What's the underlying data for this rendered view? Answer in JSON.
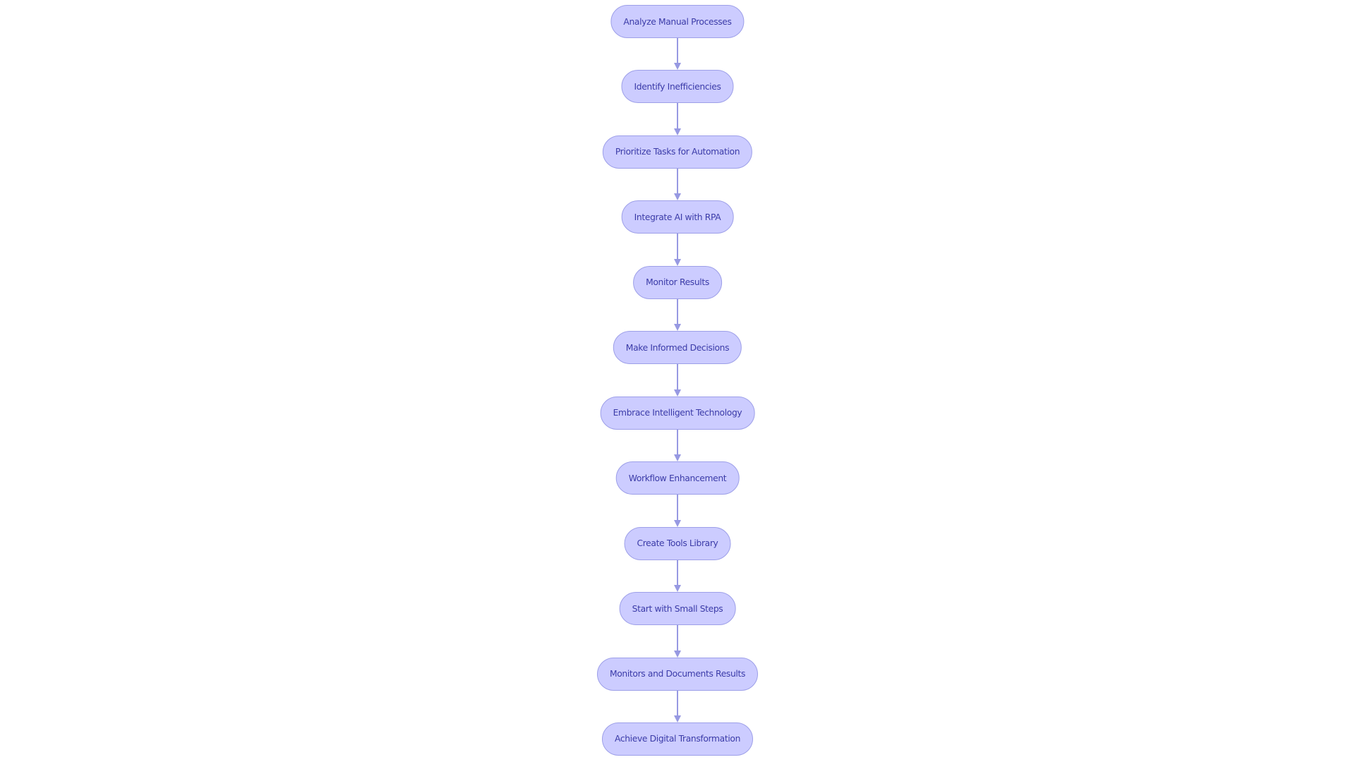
{
  "diagram": {
    "type": "flowchart",
    "direction": "top-to-bottom",
    "colors": {
      "node_fill": "#ccccff",
      "node_border": "#9d9fe8",
      "node_text": "#3b3ba8",
      "edge": "#9799e2",
      "background": "#ffffff"
    },
    "nodes": [
      {
        "id": "n1",
        "label": "Analyze Manual Processes"
      },
      {
        "id": "n2",
        "label": "Identify Inefficiencies"
      },
      {
        "id": "n3",
        "label": "Prioritize Tasks for Automation"
      },
      {
        "id": "n4",
        "label": "Integrate AI with RPA"
      },
      {
        "id": "n5",
        "label": "Monitor Results"
      },
      {
        "id": "n6",
        "label": "Make Informed Decisions"
      },
      {
        "id": "n7",
        "label": "Embrace Intelligent Technology"
      },
      {
        "id": "n8",
        "label": "Workflow Enhancement"
      },
      {
        "id": "n9",
        "label": "Create Tools Library"
      },
      {
        "id": "n10",
        "label": "Start with Small Steps"
      },
      {
        "id": "n11",
        "label": "Monitors and Documents Results"
      },
      {
        "id": "n12",
        "label": "Achieve Digital Transformation"
      }
    ],
    "edges": [
      {
        "from": "n1",
        "to": "n2"
      },
      {
        "from": "n2",
        "to": "n3"
      },
      {
        "from": "n3",
        "to": "n4"
      },
      {
        "from": "n4",
        "to": "n5"
      },
      {
        "from": "n5",
        "to": "n6"
      },
      {
        "from": "n6",
        "to": "n7"
      },
      {
        "from": "n7",
        "to": "n8"
      },
      {
        "from": "n8",
        "to": "n9"
      },
      {
        "from": "n9",
        "to": "n10"
      },
      {
        "from": "n10",
        "to": "n11"
      },
      {
        "from": "n11",
        "to": "n12"
      }
    ]
  }
}
